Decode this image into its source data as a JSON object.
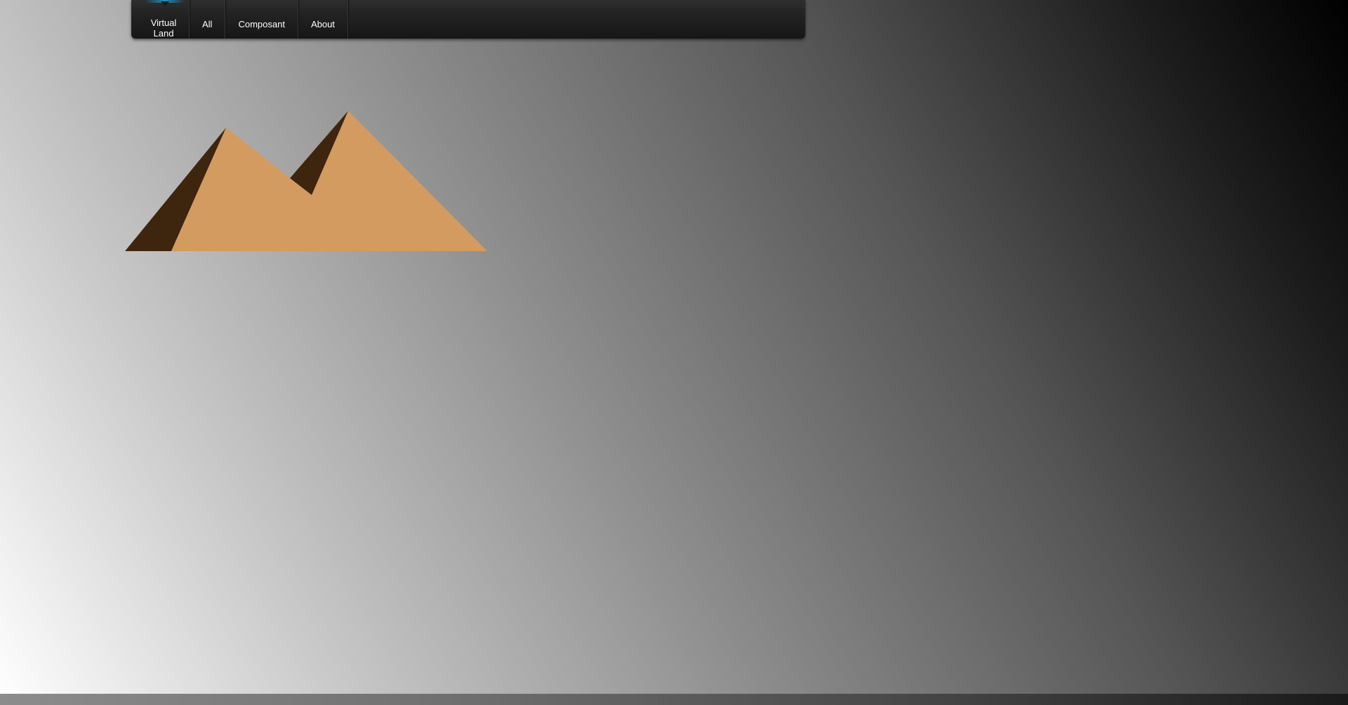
{
  "nav": {
    "items": [
      {
        "label": "Virtual Land",
        "active": true
      },
      {
        "label": "All"
      },
      {
        "label": "Composant"
      },
      {
        "label": "About"
      }
    ]
  },
  "colors": {
    "pyramid_light": "#d39b60",
    "pyramid_shadow": "#3d250e",
    "active_accent": "#1b8fc4",
    "navbar": "#1f1f1f"
  },
  "scene": {
    "icon": "pyramids"
  }
}
